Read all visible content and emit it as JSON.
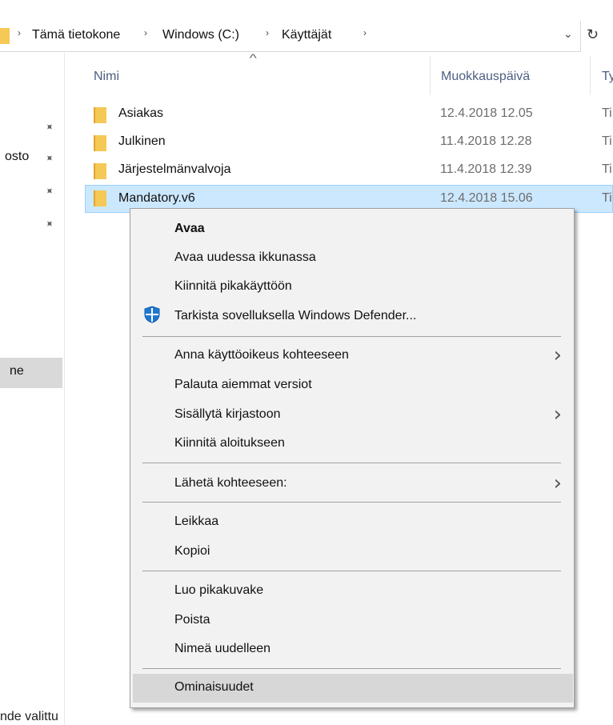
{
  "address": {
    "crumbs": [
      "Tämä tietokone",
      "Windows (C:)",
      "Käyttäjät"
    ],
    "separator": "›",
    "dropdown_glyph": "⌄",
    "refresh_glyph": "↻"
  },
  "nav": {
    "partial_item_1": "osto",
    "partial_item_2": "ne",
    "pin_glyph": "✦"
  },
  "columns": {
    "name": "Nimi",
    "modified": "Muokkauspäivä",
    "type": "Ty",
    "sort_glyph": "^"
  },
  "files": [
    {
      "name": "Asiakas",
      "date": "12.4.2018 12.05",
      "type": "Ti"
    },
    {
      "name": "Julkinen",
      "date": "11.4.2018 12.28",
      "type": "Ti"
    },
    {
      "name": "Järjestelmänvalvoja",
      "date": "11.4.2018 12.39",
      "type": "Ti"
    },
    {
      "name": "Mandatory.v6",
      "date": "12.4.2018 15.06",
      "type": "Ti"
    }
  ],
  "context_menu": {
    "open": "Avaa",
    "open_new_window": "Avaa uudessa ikkunassa",
    "pin_quick_access": "Kiinnitä pikakäyttöön",
    "scan_defender": "Tarkista sovelluksella Windows Defender...",
    "give_access": "Anna käyttöoikeus kohteeseen",
    "restore_versions": "Palauta aiemmat versiot",
    "include_library": "Sisällytä kirjastoon",
    "pin_start": "Kiinnitä aloitukseen",
    "send_to": "Lähetä kohteeseen:",
    "cut": "Leikkaa",
    "copy": "Kopioi",
    "create_shortcut": "Luo pikakuvake",
    "delete": "Poista",
    "rename": "Nimeä uudelleen",
    "properties": "Ominaisuudet",
    "submenu_glyph": "›"
  },
  "status": {
    "selection": "nde valittu"
  },
  "colors": {
    "selection_bg": "#cce8ff",
    "selection_border": "#99d1ff",
    "folder": "#f5c956",
    "menu_bg": "#f2f2f2",
    "menu_highlight": "#d7d7d7",
    "header_text": "#4d6082"
  }
}
